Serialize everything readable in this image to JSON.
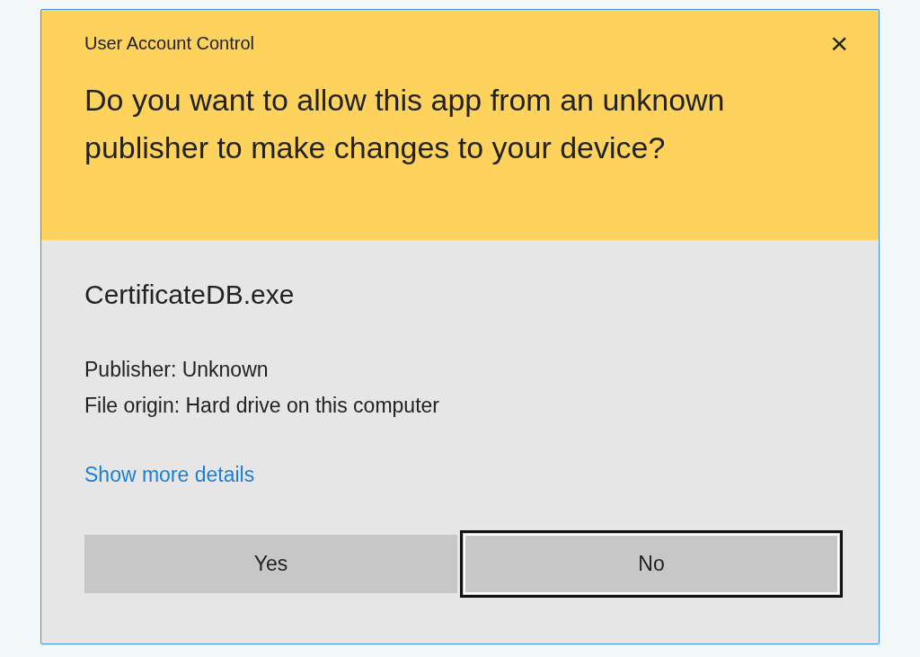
{
  "window": {
    "title": "User Account Control",
    "close": "×"
  },
  "question": "Do you want to allow this app from an unknown publisher to make changes to your device?",
  "program": "CertificateDB.exe",
  "details": [
    "Publisher: Unknown",
    "File origin: Hard drive on this computer"
  ],
  "link": "Show more details",
  "buttons": [
    {
      "label": "Yes",
      "focused": false
    },
    {
      "label": "No",
      "focused": true
    }
  ]
}
